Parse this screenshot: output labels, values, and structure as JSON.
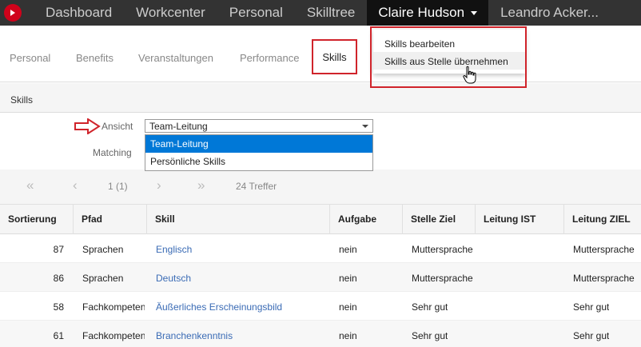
{
  "topnav": {
    "items": [
      {
        "label": "Dashboard"
      },
      {
        "label": "Workcenter"
      },
      {
        "label": "Personal"
      },
      {
        "label": "Skilltree"
      },
      {
        "label": "Claire Hudson"
      },
      {
        "label": "Leandro Acker..."
      }
    ],
    "menu": {
      "items": [
        {
          "label": "Skills bearbeiten"
        },
        {
          "label": "Skills aus Stelle übernehmen"
        }
      ]
    }
  },
  "subtabs": [
    {
      "label": "Personal"
    },
    {
      "label": "Benefits"
    },
    {
      "label": "Veranstaltungen"
    },
    {
      "label": "Performance"
    },
    {
      "label": "Skills"
    }
  ],
  "section": {
    "title": "Skills"
  },
  "filters": {
    "ansicht_label": "Ansicht",
    "matching_label": "Matching",
    "selected": "Team-Leitung",
    "options": [
      "Team-Leitung",
      "Persönliche Skills"
    ]
  },
  "pager": {
    "page": "1 (1)",
    "hits": "24 Treffer",
    "first": "«",
    "prev": "‹",
    "next": "›",
    "last": "»"
  },
  "table": {
    "headers": [
      "Sortierung",
      "Pfad",
      "Skill",
      "Aufgabe",
      "Stelle Ziel",
      "Leitung IST",
      "Leitung ZIEL"
    ],
    "rows": [
      {
        "sort": "87",
        "pfad": "Sprachen",
        "skill": "Englisch",
        "aufgabe": "nein",
        "stelle_ziel": "Muttersprache",
        "leitung_ist": "",
        "leitung_ziel": "Muttersprache"
      },
      {
        "sort": "86",
        "pfad": "Sprachen",
        "skill": "Deutsch",
        "aufgabe": "nein",
        "stelle_ziel": "Muttersprache",
        "leitung_ist": "",
        "leitung_ziel": "Muttersprache"
      },
      {
        "sort": "58",
        "pfad": "Fachkompeten",
        "skill": "Äußerliches Erscheinungsbild",
        "aufgabe": "nein",
        "stelle_ziel": "Sehr gut",
        "leitung_ist": "",
        "leitung_ziel": "Sehr gut"
      },
      {
        "sort": "61",
        "pfad": "Fachkompeten",
        "skill": "Branchenkenntnis",
        "aufgabe": "nein",
        "stelle_ziel": "Sehr gut",
        "leitung_ist": "",
        "leitung_ziel": "Sehr gut"
      }
    ]
  },
  "colors": {
    "topbar": "#333333",
    "active_top": "#111111",
    "accent_red": "#d0242b",
    "link": "#3a6bb5",
    "selected_option": "#0078d7"
  }
}
